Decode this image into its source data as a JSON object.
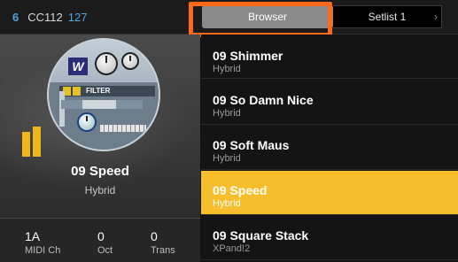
{
  "topbar": {
    "midi_channel": "6",
    "cc_label": "CC112",
    "cc_value": "127",
    "tabs": {
      "browser": "Browser",
      "setlist": "Setlist 1"
    },
    "highlight_color": "#ff6a1a"
  },
  "current_preset": {
    "name": "09 Speed",
    "category": "Hybrid",
    "plugin_art": {
      "logo": "W",
      "section_label": "FILTER"
    }
  },
  "stats": [
    {
      "value": "1A",
      "label": "MIDI Ch"
    },
    {
      "value": "0",
      "label": "Oct"
    },
    {
      "value": "0",
      "label": "Trans"
    }
  ],
  "presets": [
    {
      "name": "09 Shimmer",
      "category": "Hybrid",
      "selected": false
    },
    {
      "name": "09 So Damn Nice",
      "category": "Hybrid",
      "selected": false
    },
    {
      "name": "09 Soft Maus",
      "category": "Hybrid",
      "selected": false
    },
    {
      "name": "09 Speed",
      "category": "Hybrid",
      "selected": true
    },
    {
      "name": "09 Square Stack",
      "category": "XPand!2",
      "selected": false
    }
  ],
  "colors": {
    "accent": "#4fa8e0",
    "selected_row": "#f6be2a",
    "level_bars": "#f0b71c"
  }
}
